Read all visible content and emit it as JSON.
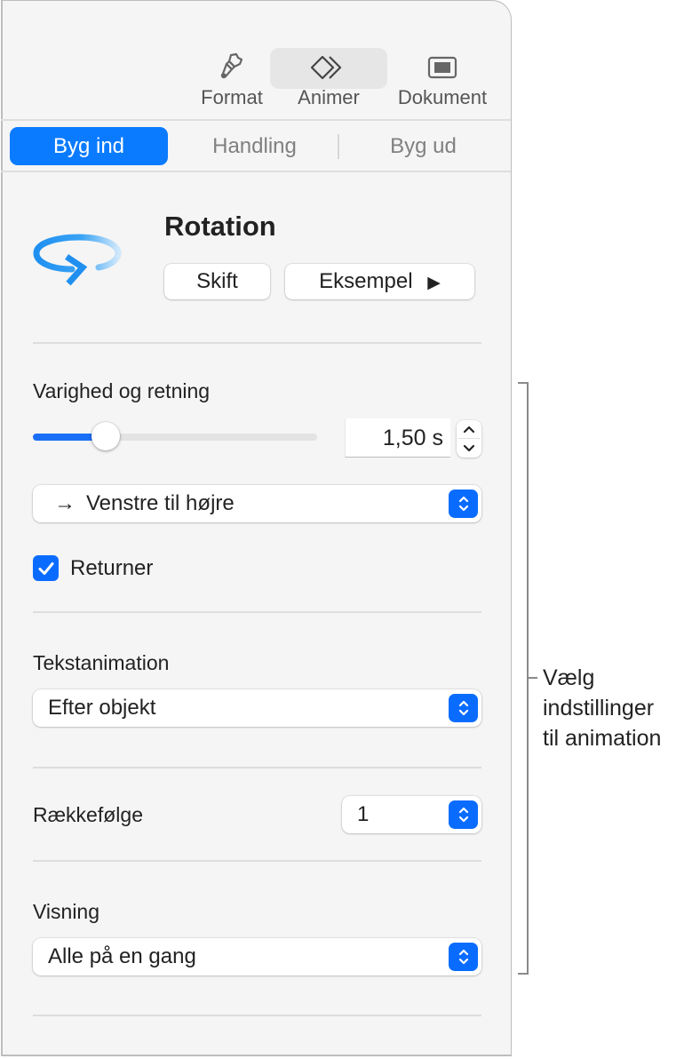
{
  "toolbar": {
    "items": [
      {
        "label": "Format",
        "icon": "paintbrush-icon",
        "selected": false
      },
      {
        "label": "Animer",
        "icon": "animate-diamonds-icon",
        "selected": true
      },
      {
        "label": "Dokument",
        "icon": "document-icon",
        "selected": false
      }
    ]
  },
  "tabs": [
    {
      "label": "Byg ind",
      "active": true
    },
    {
      "label": "Handling",
      "active": false
    },
    {
      "label": "Byg ud",
      "active": false
    }
  ],
  "effect": {
    "icon": "rotation-arrow-icon",
    "title": "Rotation",
    "change_button": "Skift",
    "preview_button": "Eksempel",
    "preview_icon": "▶"
  },
  "duration": {
    "label": "Varighed og retning",
    "slider_fraction": 0.255,
    "value": "1,50 s",
    "direction": "Venstre til højre",
    "direction_arrow": "→",
    "return_label": "Returner",
    "return_checked": true
  },
  "text_animation": {
    "label": "Tekstanimation",
    "value": "Efter objekt"
  },
  "order": {
    "label": "Rækkefølge",
    "value": "1"
  },
  "delivery": {
    "label": "Visning",
    "value": "Alle på en gang"
  },
  "callout": {
    "lines": [
      "Vælg",
      "indstillinger",
      "til animation"
    ]
  },
  "colors": {
    "accent": "#0a7bff",
    "panel_bg": "#f5f5f5"
  }
}
